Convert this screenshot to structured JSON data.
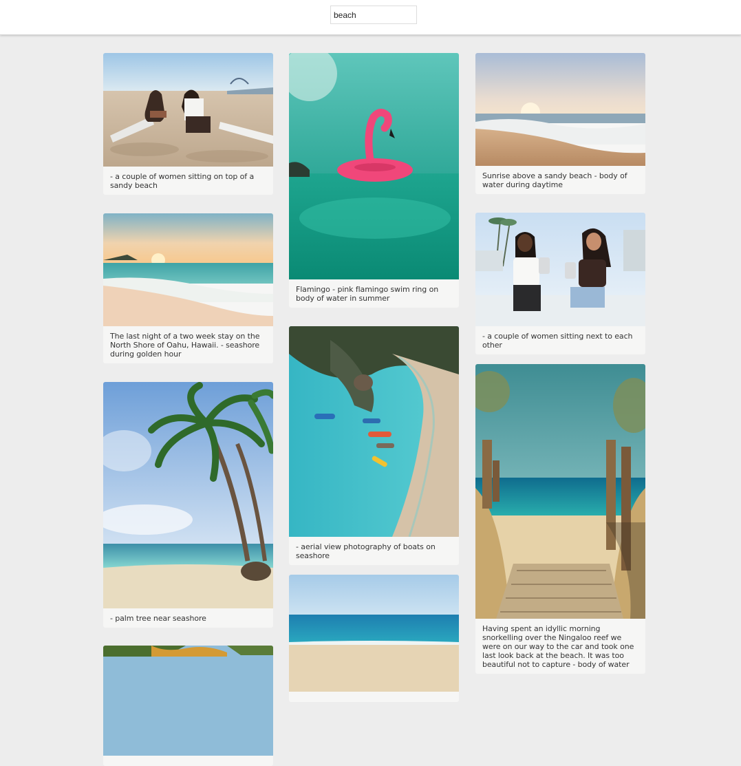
{
  "search": {
    "value": "beach"
  },
  "cards": [
    {
      "caption": "- a couple of women sitting on top of a sandy beach"
    },
    {
      "caption": "Flamingo - pink flamingo swim ring on body of water in summer"
    },
    {
      "caption": "Sunrise above a sandy beach - body of water during daytime"
    },
    {
      "caption": "The last night of a two week stay on the North Shore of Oahu, Hawaii. - seashore during golden hour"
    },
    {
      "caption": "- a couple of women sitting next to each other"
    },
    {
      "caption": "- aerial view photography of boats on seashore"
    },
    {
      "caption": "- palm tree near seashore"
    },
    {
      "caption": "Having spent an idyllic morning snorkelling over the Ningaloo reef we were on our way to the car and took one last look back at the beach. It was too beautiful not to capture - body of water"
    },
    {
      "caption": ""
    },
    {
      "caption": ""
    }
  ]
}
